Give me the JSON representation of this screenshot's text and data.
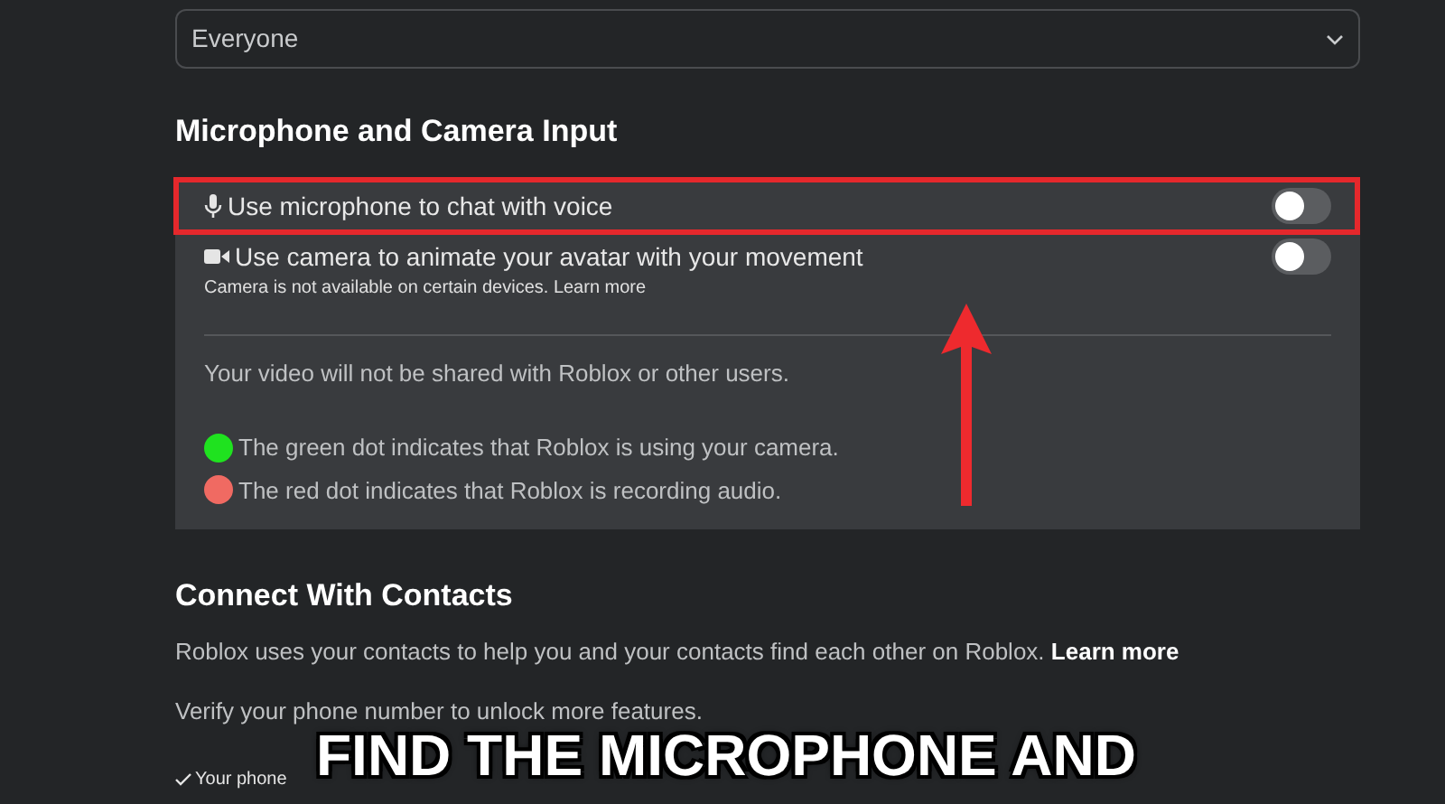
{
  "privacy_dropdown": {
    "value": "Everyone"
  },
  "microphone_camera": {
    "heading": "Microphone and Camera Input",
    "settings": [
      {
        "kind": "microphone",
        "label": "Use microphone to chat with voice",
        "on": false,
        "highlighted": true
      },
      {
        "kind": "camera",
        "label": "Use camera to animate your avatar with your movement",
        "note": "Camera is not available on certain devices.",
        "note_link": "Learn more",
        "on": false,
        "highlighted": false
      }
    ],
    "video_notice": "Your video will not be shared with Roblox or other users.",
    "indicators": [
      {
        "color": "#1fe21f",
        "text": "The green dot indicates that Roblox is using your camera."
      },
      {
        "color": "#f06a62",
        "text": "The red dot indicates that Roblox is recording audio."
      }
    ]
  },
  "contacts": {
    "heading": "Connect With Contacts",
    "description": "Roblox uses your contacts to help you and your contacts find each other on Roblox.",
    "link": "Learn more",
    "verify_text": "Verify your phone number to unlock more features.",
    "checklist": [
      "Your phone"
    ]
  },
  "caption": {
    "lines": [
      "FIND THE MICROPHONE AND"
    ]
  }
}
